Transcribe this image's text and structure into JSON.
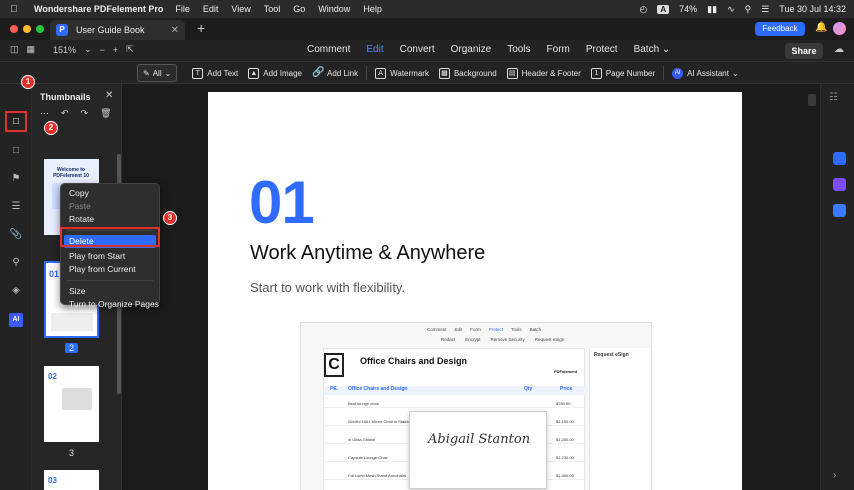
{
  "macbar": {
    "app_name": "Wondershare PDFelement Pro",
    "menus": [
      "File",
      "Edit",
      "View",
      "Tool",
      "Go",
      "Window",
      "Help"
    ],
    "battery": "74%",
    "datetime": "Tue 30 Jul  14:32",
    "input_badge": "A"
  },
  "titlebar": {
    "tab_title": "User Guide Book",
    "feedback_label": "Feedback"
  },
  "toolbar": {
    "zoom": "151%",
    "nav": [
      "Comment",
      "Edit",
      "Convert",
      "Organize",
      "Tools",
      "Form",
      "Protect",
      "Batch"
    ],
    "active_nav": "Edit",
    "share_label": "Share",
    "select_label": "All",
    "tools": [
      "Add Text",
      "Add Image",
      "Add Link",
      "Watermark",
      "Background",
      "Header & Footer",
      "Page Number"
    ],
    "ai_label": "AI Assistant"
  },
  "thumbnails": {
    "title": "Thumbnails",
    "page1_title": "Welcome to PDFelement 10",
    "page_numbers": [
      "2",
      "3"
    ],
    "page2_heading": "01",
    "page3_heading": "02",
    "page4_heading": "03"
  },
  "steps": [
    "1",
    "2",
    "3"
  ],
  "context_menu": {
    "items": [
      "Copy",
      "Paste",
      "Rotate",
      "Delete",
      "Play from Start",
      "Play from Current",
      "Size",
      "Turn to Organize Pages"
    ]
  },
  "page": {
    "number": "01",
    "heading": "Work Anytime & Anywhere",
    "subheading": "Start to work with flexibility."
  },
  "screenshot": {
    "tabs": [
      "Comment",
      "Edit",
      "Form",
      "Protect",
      "Tools",
      "Batch"
    ],
    "tools": [
      "Redact",
      "Encrypt",
      "Remove Security",
      "Request eSign"
    ],
    "doc_letter": "C",
    "doc_title": "Office Chairs and Design",
    "brand": "PDFelement",
    "header_cols": [
      "PE.",
      "Office Chairs and Design",
      "Qty",
      "Price"
    ],
    "rows": [
      {
        "name": "Best lounge chair",
        "price": "$780.00"
      },
      {
        "name": "Ghidini 1961 Mixed Chair in Stainless S",
        "price": "$1,150.00"
      },
      {
        "name": "in Gilda Ghidini",
        "price": "$1,250.00"
      },
      {
        "name": "Capsule Lounge Chair",
        "price": "$1,230.00"
      },
      {
        "name": "Fat Lionn Mesh Stand Armchairs",
        "price": "$1,400.00"
      }
    ],
    "side_title": "Request eSign",
    "signature": "Abigail Stanton"
  }
}
